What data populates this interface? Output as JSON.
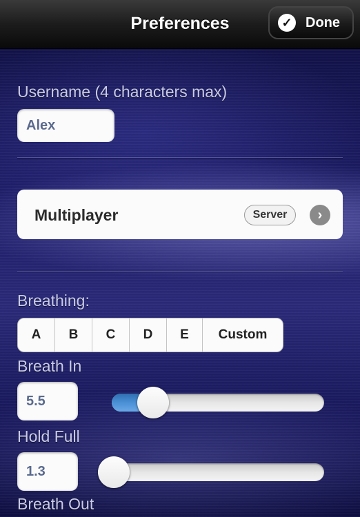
{
  "header": {
    "title": "Preferences",
    "done_label": "Done",
    "done_icon": "checkmark-icon"
  },
  "username": {
    "label": "Username (4 characters max)",
    "value": "Alex"
  },
  "multiplayer": {
    "label": "Multiplayer",
    "badge": "Server",
    "arrow_icon": "chevron-right-circle-icon"
  },
  "breathing": {
    "label": "Breathing:",
    "options": [
      "A",
      "B",
      "C",
      "D",
      "E",
      "Custom"
    ]
  },
  "breath_in": {
    "label": "Breath In",
    "value": "5.5",
    "slider_fraction": 0.14
  },
  "hold_full": {
    "label": "Hold Full",
    "value": "1.3",
    "slider_fraction": 0.0
  },
  "breath_out": {
    "label": "Breath Out"
  },
  "colors": {
    "slider_fill": "#4a90d6",
    "label_text": "#c9cbe6",
    "field_text": "#5a6a8e"
  }
}
